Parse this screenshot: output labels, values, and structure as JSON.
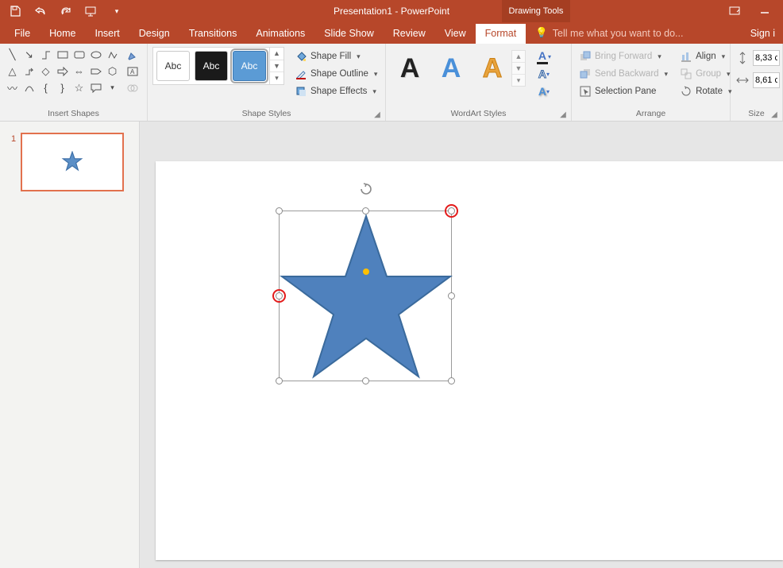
{
  "title": "Presentation1 - PowerPoint",
  "context_tools_label": "Drawing Tools",
  "tabs": {
    "file": "File",
    "home": "Home",
    "insert": "Insert",
    "design": "Design",
    "transitions": "Transitions",
    "animations": "Animations",
    "slideshow": "Slide Show",
    "review": "Review",
    "view": "View",
    "format": "Format"
  },
  "tellme_placeholder": "Tell me what you want to do...",
  "signin": "Sign i",
  "groups": {
    "insert_shapes": "Insert Shapes",
    "shape_styles": "Shape Styles",
    "wordart_styles": "WordArt Styles",
    "arrange": "Arrange",
    "size": "Size"
  },
  "style_label": "Abc",
  "shape_menu": {
    "fill": "Shape Fill",
    "outline": "Shape Outline",
    "effects": "Shape Effects"
  },
  "arrange_menu": {
    "bring_forward": "Bring Forward",
    "send_backward": "Send Backward",
    "selection_pane": "Selection Pane",
    "align": "Align",
    "group": "Group",
    "rotate": "Rotate"
  },
  "size": {
    "height": "8,33 c",
    "width": "8,61 c"
  },
  "slide_number": "1",
  "wa_letter": "A"
}
